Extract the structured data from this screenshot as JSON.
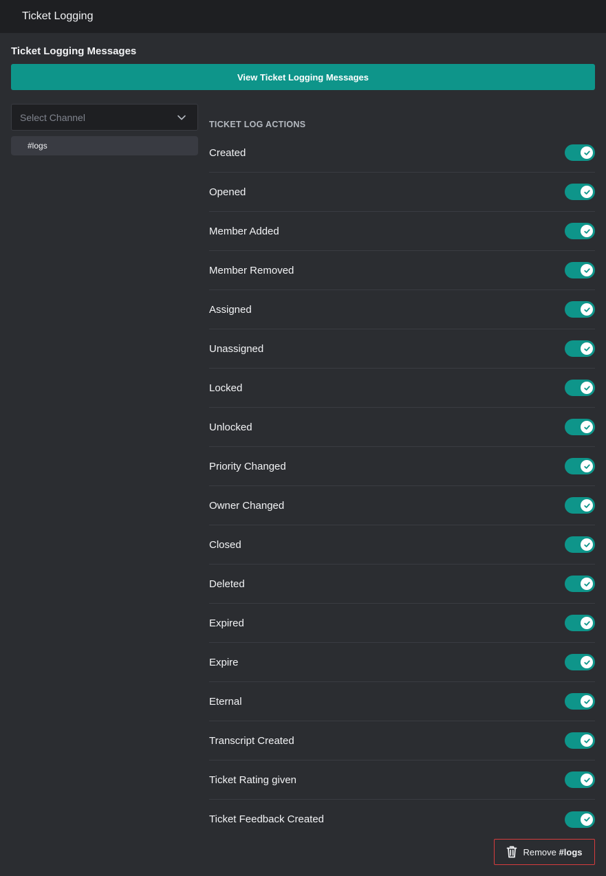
{
  "window": {
    "title": "Ticket Logging"
  },
  "messages_section": {
    "title": "Ticket Logging Messages",
    "view_button_label": "View Ticket Logging Messages"
  },
  "channel_select": {
    "placeholder": "Select Channel",
    "selected_channel": "#logs"
  },
  "log_actions": {
    "heading": "TICKET LOG ACTIONS",
    "items": [
      {
        "label": "Created",
        "enabled": true
      },
      {
        "label": "Opened",
        "enabled": true
      },
      {
        "label": "Member Added",
        "enabled": true
      },
      {
        "label": "Member Removed",
        "enabled": true
      },
      {
        "label": "Assigned",
        "enabled": true
      },
      {
        "label": "Unassigned",
        "enabled": true
      },
      {
        "label": "Locked",
        "enabled": true
      },
      {
        "label": "Unlocked",
        "enabled": true
      },
      {
        "label": "Priority Changed",
        "enabled": true
      },
      {
        "label": "Owner Changed",
        "enabled": true
      },
      {
        "label": "Closed",
        "enabled": true
      },
      {
        "label": "Deleted",
        "enabled": true
      },
      {
        "label": "Expired",
        "enabled": true
      },
      {
        "label": "Expire",
        "enabled": true
      },
      {
        "label": "Eternal",
        "enabled": true
      },
      {
        "label": "Transcript Created",
        "enabled": true
      },
      {
        "label": "Ticket Rating given",
        "enabled": true
      },
      {
        "label": "Ticket Feedback Created",
        "enabled": true
      }
    ]
  },
  "remove_button": {
    "prefix": "Remove",
    "channel": "#logs"
  },
  "colors": {
    "accent": "#0e958a",
    "background": "#2b2d31",
    "header_background": "#1e1f22",
    "danger_border": "#d83c3e"
  },
  "icons": {
    "select_chevron": "chevron-down-icon",
    "toggle_check": "check-icon",
    "remove": "trash-icon"
  }
}
